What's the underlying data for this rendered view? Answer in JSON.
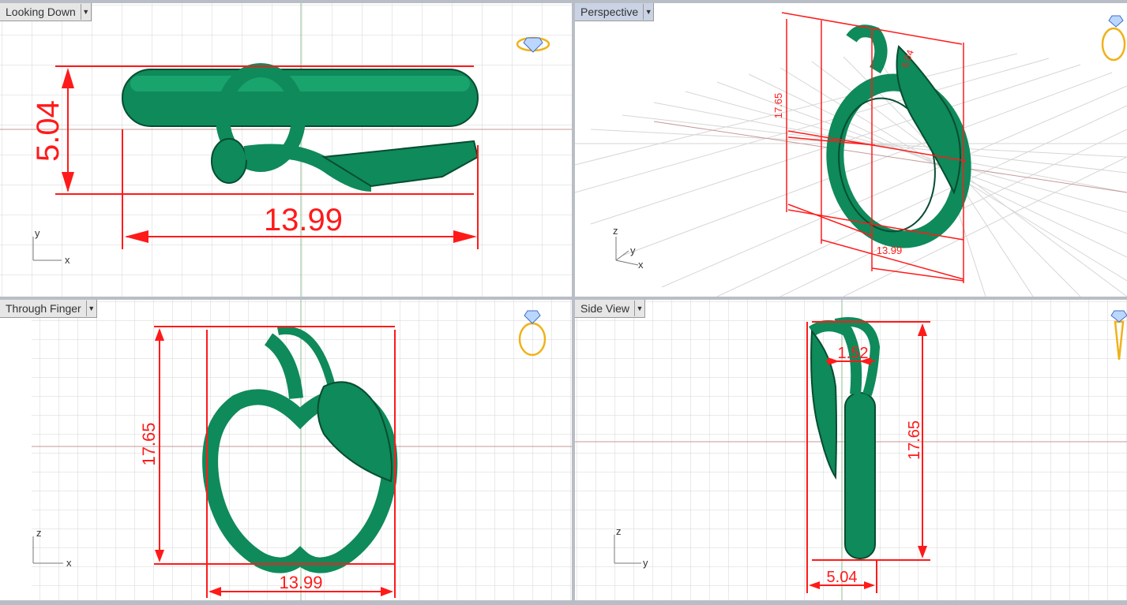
{
  "colors": {
    "model": "#0f8a5a",
    "dimension": "#ff1a1a",
    "grid": "#d4d4d4",
    "axis_x": "#c79a9a",
    "axis_y": "#8fbf8f",
    "active_tab": "#c9d3e4"
  },
  "viewports": [
    {
      "id": "top",
      "title": "Looking Down",
      "dims": [
        "5.04",
        "13.99"
      ],
      "axes": [
        "y",
        "x"
      ],
      "icon": "ring-top-view-icon"
    },
    {
      "id": "persp",
      "title": "Perspective",
      "dims": [
        "17.65",
        "13.99",
        "5.04"
      ],
      "axes": [
        "z",
        "y",
        "x"
      ],
      "icon": "ring-perspective-icon"
    },
    {
      "id": "front",
      "title": "Through Finger",
      "dims": [
        "17.65",
        "13.99"
      ],
      "axes": [
        "z",
        "x"
      ],
      "icon": "ring-front-view-icon"
    },
    {
      "id": "side",
      "title": "Side View",
      "dims": [
        "1.52",
        "17.65",
        "5.04"
      ],
      "axes": [
        "z",
        "y"
      ],
      "icon": "ring-side-view-icon"
    }
  ]
}
